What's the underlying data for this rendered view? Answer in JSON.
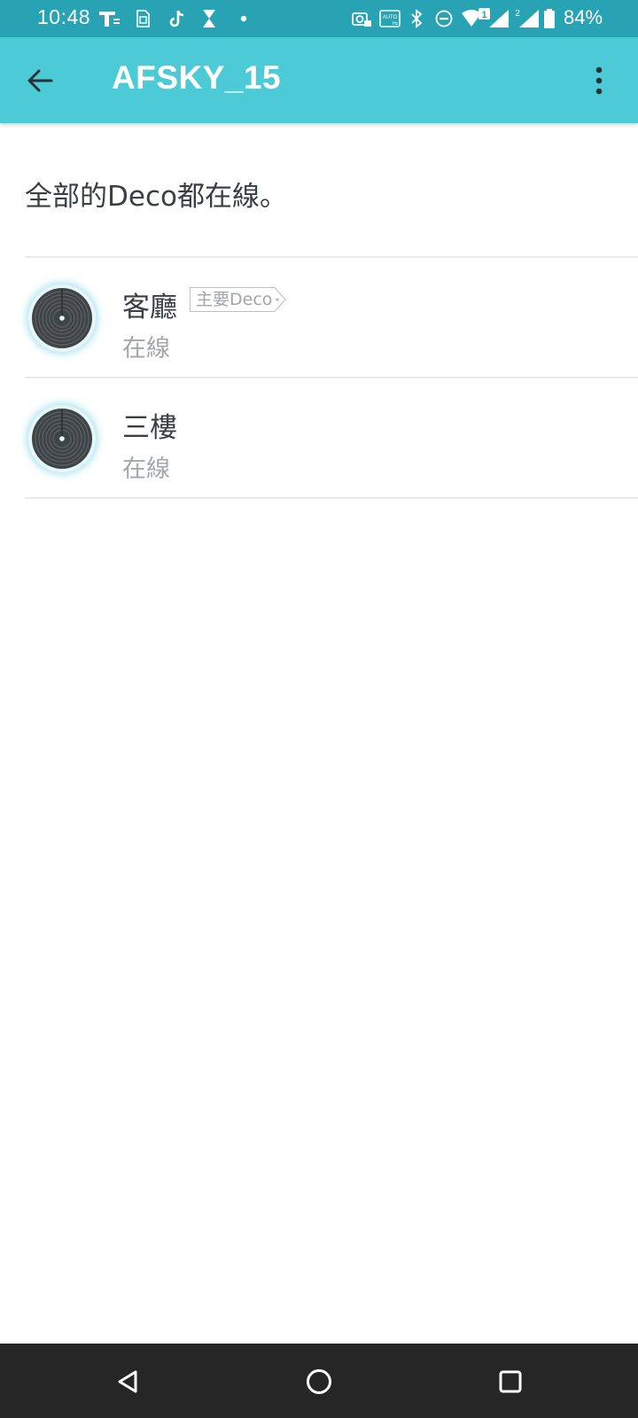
{
  "status_bar": {
    "time": "10:48",
    "battery_percent": "84%",
    "icons": [
      "carrier-t-icon",
      "sim-card-icon",
      "tiktok-icon",
      "notification-app-icon",
      "dot-icon",
      "camera-lock-icon",
      "auto-hz-icon",
      "bluetooth-icon",
      "do-not-disturb-icon",
      "wifi-icon",
      "signal-sim1-icon",
      "signal-sim2-icon",
      "battery-icon"
    ],
    "wifi_badge": "1",
    "sim2_badge": "2",
    "auto_label": "AUTO",
    "hz_label": "Hz"
  },
  "app_bar": {
    "title": "AFSKY_15",
    "back_icon": "arrow-left-icon",
    "menu_icon": "more-vert-icon"
  },
  "summary": "全部的Deco都在線。",
  "devices": [
    {
      "name": "客廳",
      "status": "在線",
      "tag": "主要Deco",
      "icon": "deco-device-icon"
    },
    {
      "name": "三樓",
      "status": "在線",
      "icon": "deco-device-icon"
    }
  ],
  "nav_bar": {
    "back": "nav-back-icon",
    "home": "nav-home-icon",
    "recents": "nav-recents-icon"
  },
  "colors": {
    "status_bar": "#27a3b4",
    "app_bar": "#4ccbd7",
    "nav_bar": "#262626",
    "text_primary": "#3a3f44",
    "text_secondary": "#a3a7ab"
  }
}
